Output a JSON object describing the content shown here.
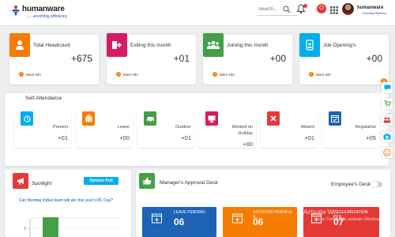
{
  "header": {
    "brand": "humanware",
    "tagline": "......enriching  efficiency",
    "search_placeholder": "Search...",
    "mini_brand": "humanware",
    "mini_tagline": "enriching efficiency"
  },
  "stats": [
    {
      "title": "Total Headcount",
      "value": "+675",
      "more": "More info",
      "icon": "person-icon",
      "color": "#f57c00"
    },
    {
      "title": "Exiting this month",
      "value": "+01",
      "more": "More info",
      "icon": "exit-icon",
      "color": "#d81b60"
    },
    {
      "title": "Joining this month",
      "value": "+00",
      "more": "More info",
      "icon": "group-icon",
      "color": "#43a047"
    },
    {
      "title": "Job Opening's",
      "value": "+00",
      "more": "More info",
      "icon": "badge-icon",
      "color": "#00aeef"
    }
  ],
  "attendance": {
    "title": "Self-Attendance",
    "items": [
      {
        "label": "Present",
        "value": "+01",
        "icon": "clock-icon",
        "color": "#00aeef"
      },
      {
        "label": "Leave",
        "value": "+00",
        "icon": "luggage-icon",
        "color": "#f57c00"
      },
      {
        "label": "Outdoor",
        "value": "+01",
        "icon": "car-icon",
        "color": "#43a047"
      },
      {
        "label": "Worked on Holiday",
        "value": "+00",
        "icon": "monitor-icon",
        "color": "#d81b60"
      },
      {
        "label": "Absent",
        "value": "+01",
        "icon": "x-icon",
        "color": "#e53935"
      },
      {
        "label": "Regularise",
        "value": "+05",
        "icon": "calendar-check-icon",
        "color": "#1e63b5"
      }
    ]
  },
  "spotlight": {
    "title": "Spotlight",
    "poll_label": "Opinion Poll",
    "question": "Can Mumbai Indian team will win this year's IPL Cup?",
    "chart_ticks": [
      "3",
      "2"
    ],
    "bar_color": "#43a047"
  },
  "manager": {
    "title": "Manager's Approval Desk",
    "employee_desk_label": "Employee's Desk",
    "tiles": [
      {
        "label": "LEAVE PENDING",
        "value": "06",
        "color": "#1e63b5"
      },
      {
        "label": "OUTDOOR PENDING A...",
        "value": "06",
        "color": "#f57c00"
      },
      {
        "label": "REGULARIZATION PEN...",
        "value": "07",
        "color": "#e53935"
      }
    ],
    "watermark_title": "Activate W...",
    "watermark_sub": "Go to Settings to activate Windows."
  },
  "rail": {
    "badge": "1",
    "items": [
      {
        "icon": "chat-icon",
        "color": "#00aeef"
      },
      {
        "icon": "cart-icon",
        "color": "#43a047"
      },
      {
        "icon": "people-icon",
        "color": "#e53935"
      },
      {
        "icon": "camera-icon",
        "color": "#00aeef"
      },
      {
        "icon": "smiley-icon",
        "color": "#f57c00"
      }
    ]
  }
}
